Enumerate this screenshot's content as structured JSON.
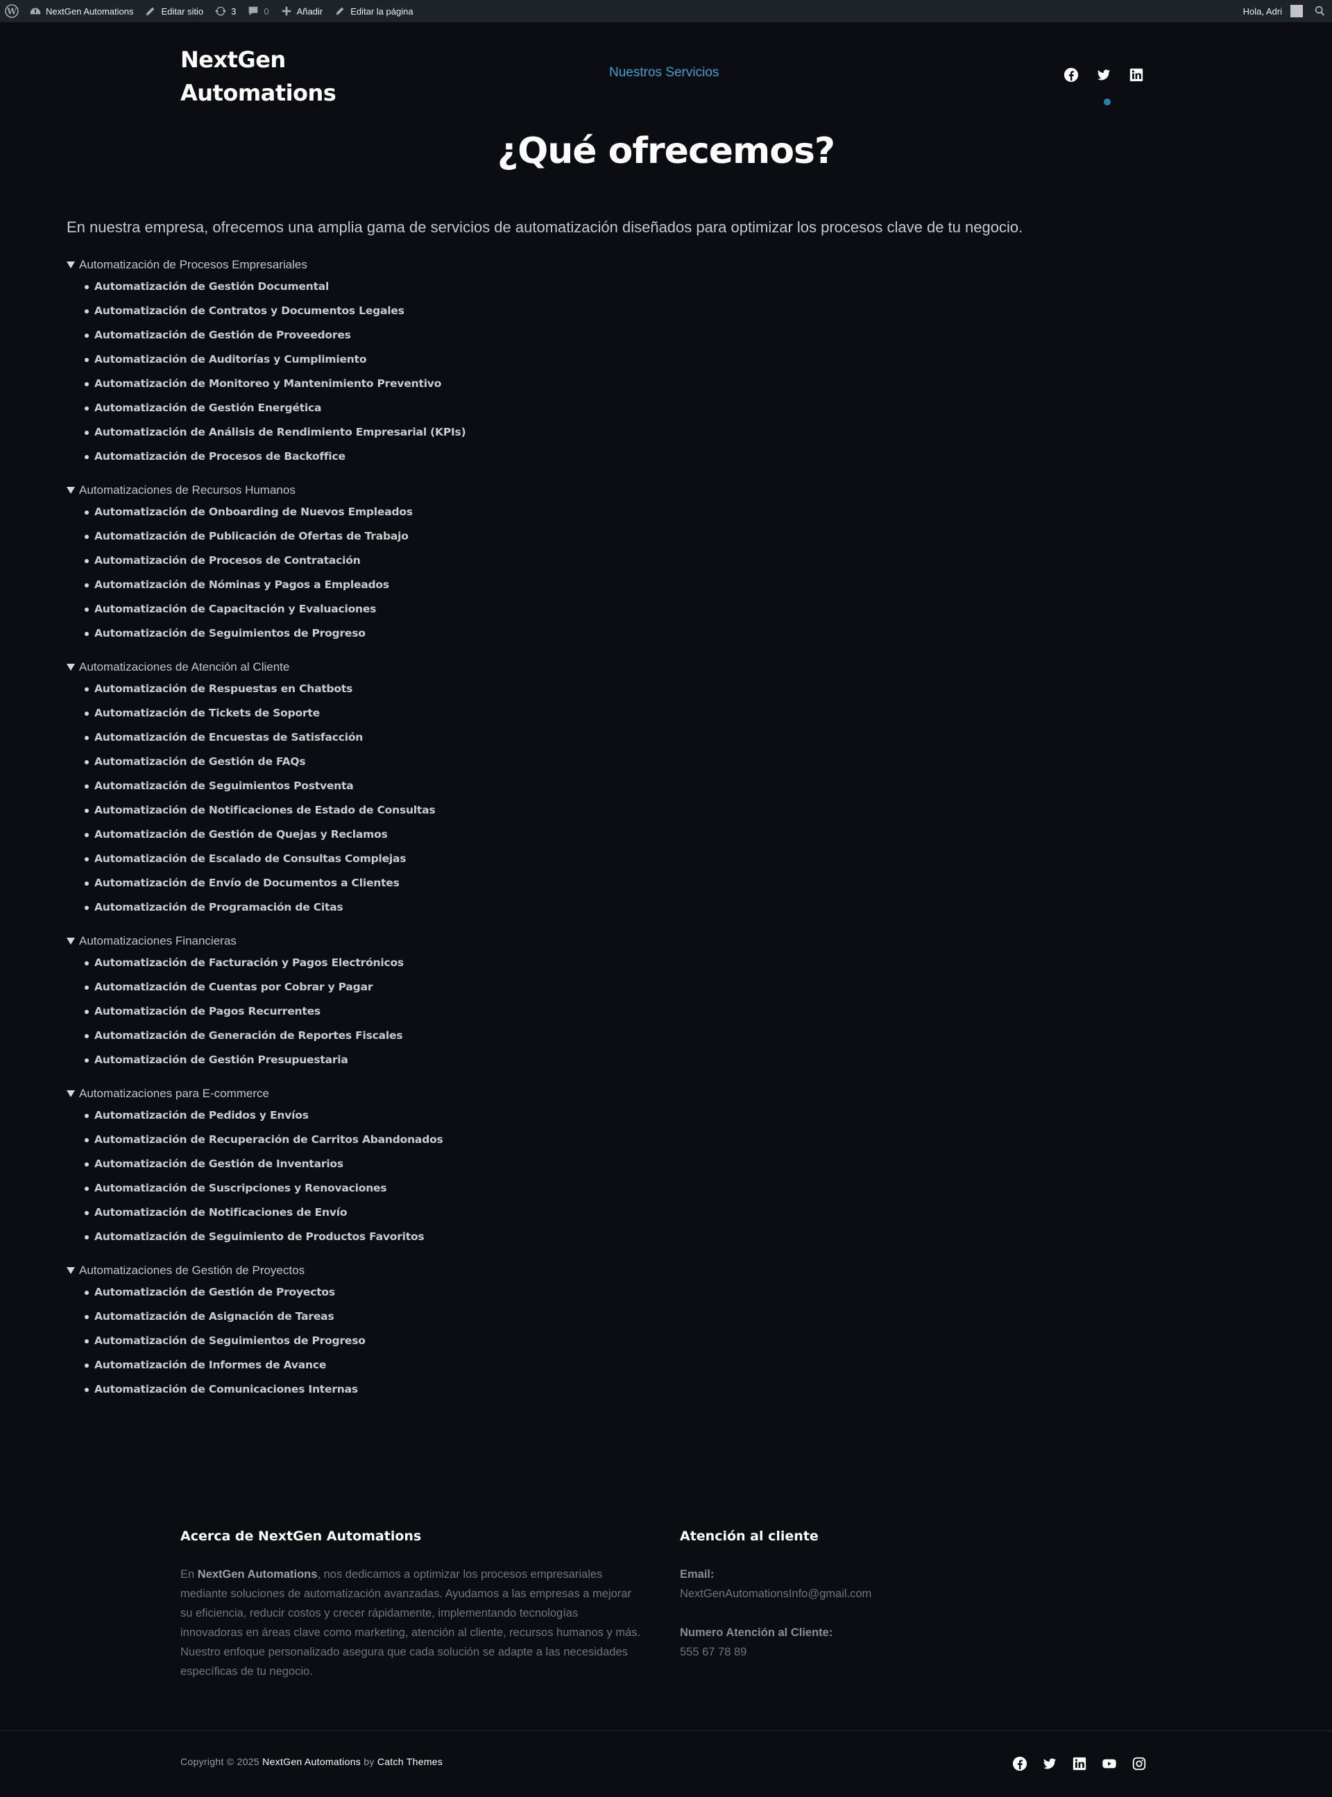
{
  "admin_bar": {
    "site_name": "NextGen Automations",
    "edit_site": "Editar sitio",
    "updates_count": "3",
    "comments_count": "0",
    "add_new": "Añadir",
    "edit_page": "Editar la página",
    "greeting": "Hola, Adri"
  },
  "header": {
    "site_title_line1": "NextGen",
    "site_title_line2": "Automations",
    "nav_item": "Nuestros Servicios",
    "social_icons": [
      "facebook-icon",
      "twitter-icon",
      "linkedin-icon"
    ]
  },
  "main": {
    "heading": "¿Qué ofrecemos?",
    "intro": "En nuestra empresa, ofrecemos una amplia gama de servicios de automatización diseñados para optimizar los procesos clave de tu negocio.",
    "sections": [
      {
        "title": "Automatización de Procesos Empresariales",
        "items": [
          "Automatización de Gestión Documental",
          "Automatización de Contratos y Documentos Legales",
          "Automatización de Gestión de Proveedores",
          "Automatización de Auditorías y Cumplimiento",
          "Automatización de Monitoreo y Mantenimiento Preventivo",
          "Automatización de Gestión Energética",
          "Automatización de Análisis de Rendimiento Empresarial (KPIs)",
          "Automatización de Procesos de Backoffice"
        ]
      },
      {
        "title": "Automatizaciones de Recursos Humanos",
        "items": [
          "Automatización de Onboarding de Nuevos Empleados",
          "Automatización de Publicación de Ofertas de Trabajo",
          "Automatización de Procesos de Contratación",
          "Automatización de Nóminas y Pagos a Empleados",
          "Automatización de Capacitación y Evaluaciones",
          "Automatización de Seguimientos de Progreso"
        ]
      },
      {
        "title": "Automatizaciones de Atención al Cliente",
        "items": [
          "Automatización de Respuestas en Chatbots",
          "Automatización de Tickets de Soporte",
          "Automatización de Encuestas de Satisfacción",
          "Automatización de Gestión de FAQs",
          "Automatización de Seguimientos Postventa",
          "Automatización de Notificaciones de Estado de Consultas",
          "Automatización de Gestión de Quejas y Reclamos",
          "Automatización de Escalado de Consultas Complejas",
          "Automatización de Envío de Documentos a Clientes",
          "Automatización de Programación de Citas"
        ]
      },
      {
        "title": "Automatizaciones Financieras",
        "items": [
          "Automatización de Facturación y Pagos Electrónicos",
          "Automatización de Cuentas por Cobrar y Pagar",
          "Automatización de Pagos Recurrentes",
          "Automatización de Generación de Reportes Fiscales",
          "Automatización de Gestión Presupuestaria"
        ]
      },
      {
        "title": "Automatizaciones para E-commerce",
        "items": [
          "Automatización de Pedidos y Envíos",
          "Automatización de Recuperación de Carritos Abandonados",
          "Automatización de Gestión de Inventarios",
          "Automatización de Suscripciones y Renovaciones",
          "Automatización de Notificaciones de Envío",
          "Automatización de Seguimiento de Productos Favoritos"
        ]
      },
      {
        "title": "Automatizaciones de Gestión de Proyectos",
        "items": [
          "Automatización de Gestión de Proyectos",
          "Automatización de Asignación de Tareas",
          "Automatización de Seguimientos de Progreso",
          "Automatización de Informes de Avance",
          "Automatización de Comunicaciones Internas"
        ]
      }
    ]
  },
  "footer": {
    "about_title": "Acerca de NextGen Automations",
    "about_prefix": "En ",
    "about_brand": "NextGen Automations",
    "about_text": ", nos dedicamos a optimizar los procesos empresariales mediante soluciones de automatización avanzadas. Ayudamos a las empresas a mejorar su eficiencia, reducir costos y crecer rápidamente, implementando tecnologías innovadoras en áreas clave como marketing, atención al cliente, recursos humanos y más. Nuestro enfoque personalizado asegura que cada solución se adapte a las necesidades específicas de tu negocio.",
    "contact_title": "Atención al cliente",
    "email_label": "Email:",
    "email_value": "NextGenAutomationsInfo@gmail.com",
    "phone_label": "Numero Atención al Cliente:",
    "phone_value": "555 67 78 89",
    "copyright_prefix": "Copyright © 2025 ",
    "copyright_brand": "NextGen Automations",
    "copyright_by": " by ",
    "copyright_theme": "Catch Themes",
    "social_icons": [
      "facebook-icon",
      "twitter-icon",
      "linkedin-icon",
      "youtube-icon",
      "instagram-icon"
    ]
  },
  "colors": {
    "background": "#0b0d12",
    "admin_bar": "#1d2327",
    "accent": "#3aa0d6",
    "text": "#d6d7da"
  }
}
